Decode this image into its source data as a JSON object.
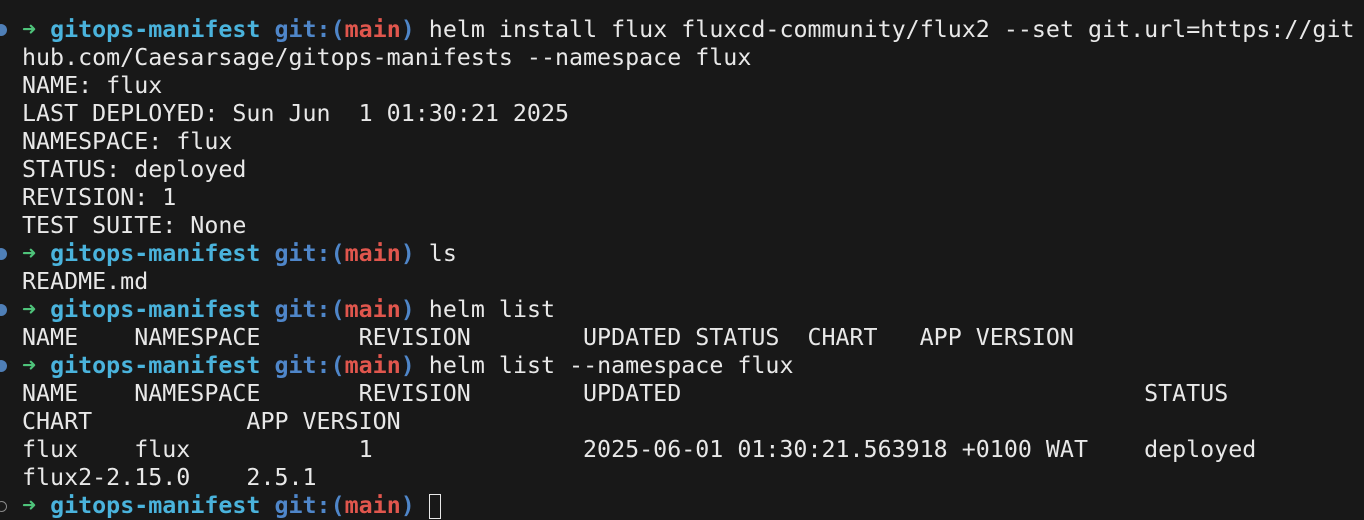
{
  "prompt": {
    "arrow": "➜",
    "directory": "gitops-manifest",
    "git_prefix": "git:(",
    "branch": "main",
    "git_suffix": ")"
  },
  "colors": {
    "background": "#181818",
    "text": "#e8e8e8",
    "arrow": "#4ec37a",
    "directory": "#4ab3dc",
    "git": "#4f86c9",
    "branch": "#e0564d",
    "status_dot": "#4f7fb7"
  },
  "lines": [
    {
      "cmd": "helm install flux fluxcd-community/flux2 --set git.url=https://git"
    },
    {
      "out": "hub.com/Caesarsage/gitops-manifests --namespace flux"
    },
    {
      "out": "NAME: flux"
    },
    {
      "out": "LAST DEPLOYED: Sun Jun  1 01:30:21 2025"
    },
    {
      "out": "NAMESPACE: flux"
    },
    {
      "out": "STATUS: deployed"
    },
    {
      "out": "REVISION: 1"
    },
    {
      "out": "TEST SUITE: None"
    },
    {
      "cmd": "ls"
    },
    {
      "out": "README.md"
    },
    {
      "cmd": "helm list"
    },
    {
      "out": "NAME    NAMESPACE       REVISION        UPDATED STATUS  CHART   APP VERSION"
    },
    {
      "cmd": "helm list --namespace flux"
    },
    {
      "out": "NAME    NAMESPACE       REVISION        UPDATED                                 STATUS"
    },
    {
      "out": "CHART           APP VERSION"
    },
    {
      "out": "flux    flux            1               2025-06-01 01:30:21.563918 +0100 WAT    deployed"
    },
    {
      "out": "flux2-2.15.0    2.5.1"
    },
    {
      "cmd": "",
      "active": true
    }
  ]
}
